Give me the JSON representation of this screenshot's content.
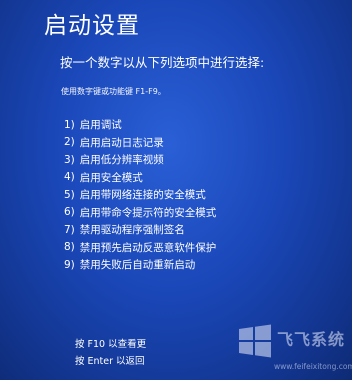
{
  "header": {
    "title": "启动设置"
  },
  "instruction": "按一个数字以从下列选项中进行选择:",
  "hint": "使用数字键或功能键 F1-F9。",
  "options": [
    {
      "num": "1)",
      "label": "启用调试"
    },
    {
      "num": "2)",
      "label": "启用启动日志记录"
    },
    {
      "num": "3)",
      "label": "启用低分辨率视频"
    },
    {
      "num": "4)",
      "label": "启用安全模式"
    },
    {
      "num": "5)",
      "label": "启用带网络连接的安全模式"
    },
    {
      "num": "6)",
      "label": "启用带命令提示符的安全模式"
    },
    {
      "num": "7)",
      "label": "禁用驱动程序强制签名"
    },
    {
      "num": "8)",
      "label": "禁用预先启动反恶意软件保护"
    },
    {
      "num": "9)",
      "label": "禁用失败后自动重新启动"
    }
  ],
  "footer": {
    "more_options": "按 F10 以查看更",
    "return": "按 Enter 以返回"
  },
  "watermark": {
    "brand": "飞飞系统",
    "url": "www.feifeixitong.com"
  },
  "colors": {
    "background": "#1a47b8",
    "text": "#ffffff"
  }
}
